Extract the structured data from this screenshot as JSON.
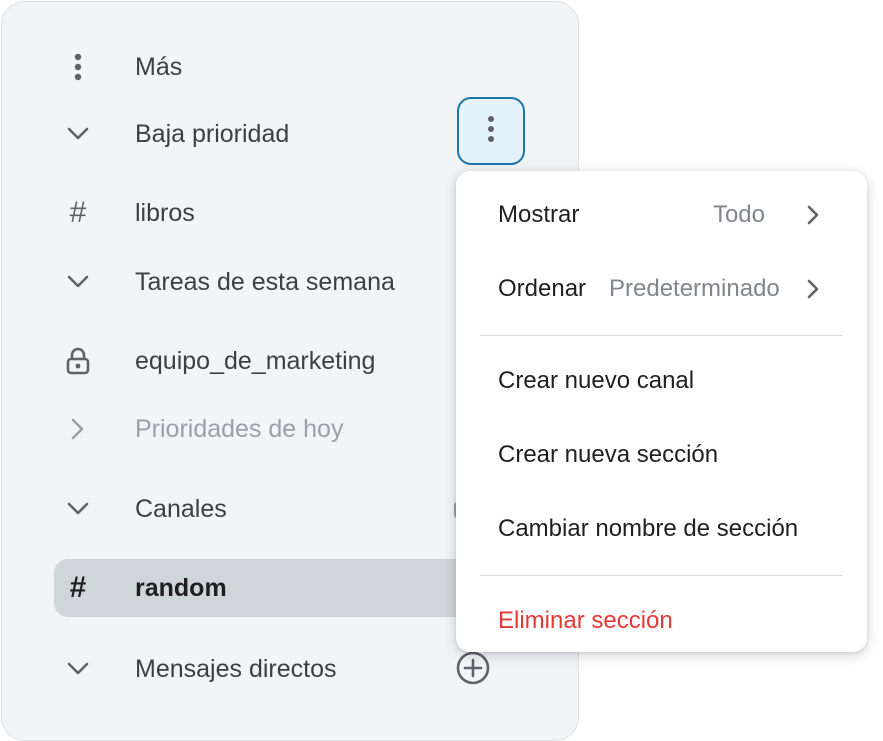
{
  "sidebar": {
    "items": [
      {
        "label": "Más",
        "icon": "more-vertical-icon"
      },
      {
        "label": "Baja prioridad",
        "icon": "chevron-down-icon"
      },
      {
        "label": "libros",
        "icon": "hash-icon"
      },
      {
        "label": "Tareas de esta semana",
        "icon": "chevron-down-icon"
      },
      {
        "label": "equipo_de_marketing",
        "icon": "lock-icon"
      },
      {
        "label": "Prioridades de hoy",
        "icon": "chevron-right-icon"
      },
      {
        "label": "Canales",
        "icon": "chevron-down-icon"
      },
      {
        "label": "random",
        "icon": "hash-icon",
        "selected": true
      },
      {
        "label": "Mensajes directos",
        "icon": "chevron-down-icon"
      }
    ],
    "hash_glyph": "#"
  },
  "menu": {
    "items": [
      {
        "label": "Mostrar",
        "value": "Todo"
      },
      {
        "label": "Ordenar",
        "value": "Predeterminado"
      },
      {
        "label": "Crear nuevo canal"
      },
      {
        "label": "Crear nueva sección"
      },
      {
        "label": "Cambiar nombre de sección"
      },
      {
        "label": "Eliminar sección",
        "danger": true
      }
    ]
  },
  "colors": {
    "accent_border": "#1e74a8",
    "accent_fill": "#e3f2fb",
    "danger": "#e53935",
    "selected_row": "#cfd6da",
    "sidebar_bg": "#f1f5f8"
  }
}
